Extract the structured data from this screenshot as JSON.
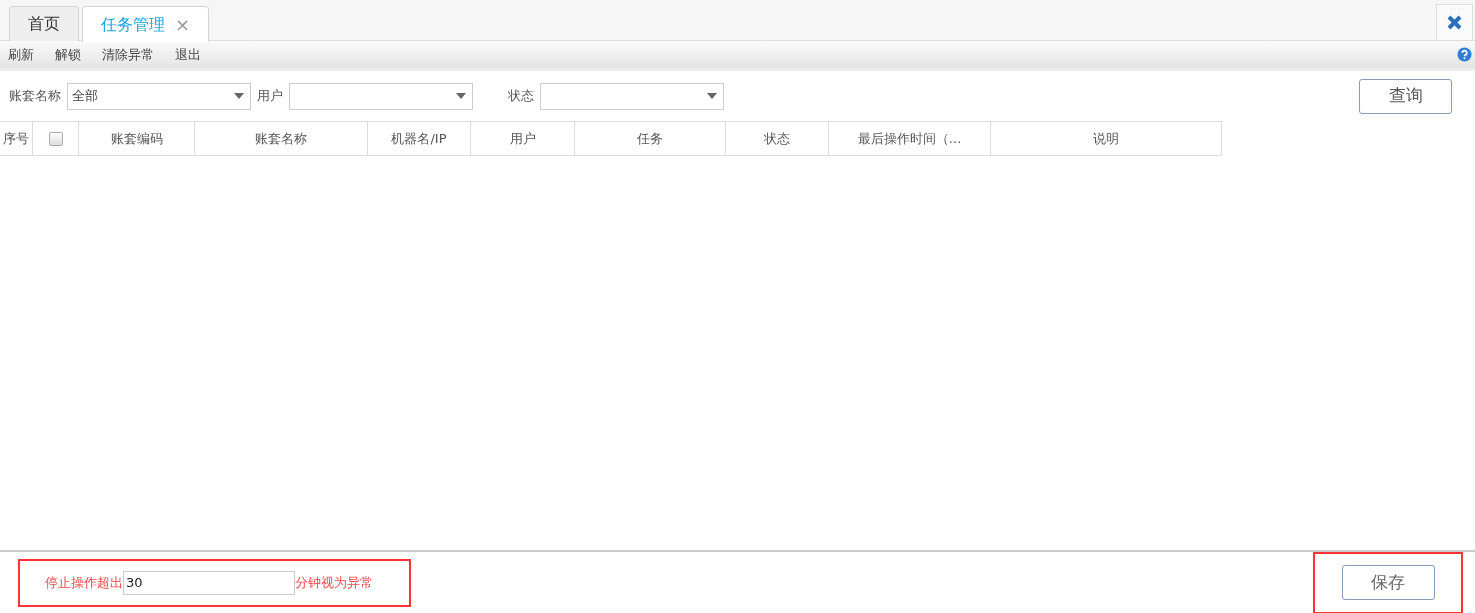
{
  "tabs": [
    {
      "label": "首页",
      "selected": false
    },
    {
      "label": "任务管理",
      "selected": true,
      "close": "×"
    }
  ],
  "toolbar": [
    "刷新",
    "解锁",
    "清除异常",
    "退出"
  ],
  "filters": [
    {
      "label": "账套名称",
      "value": "全部"
    },
    {
      "label": "用户"
    },
    {
      "label": "状态"
    }
  ],
  "query_button": "查询",
  "table": {
    "columns": [
      {
        "kind": "text",
        "label": "序号"
      },
      {
        "kind": "checkbox",
        "checked": false
      },
      {
        "kind": "text",
        "label": "账套编码"
      },
      {
        "kind": "text",
        "label": "账套名称"
      },
      {
        "kind": "text",
        "label": "机器名/IP"
      },
      {
        "kind": "text",
        "label": "用户"
      },
      {
        "kind": "text",
        "label": "任务"
      },
      {
        "kind": "text",
        "label": "状态"
      },
      {
        "kind": "text",
        "label": "最后操作时间（…"
      },
      {
        "kind": "text",
        "label": "说明"
      }
    ]
  },
  "footer": {
    "prefix": "停止操作超出",
    "value": "30",
    "suffix": "分钟视为异常",
    "highlighted": true,
    "save_button": "保存",
    "save_highlighted": true
  }
}
